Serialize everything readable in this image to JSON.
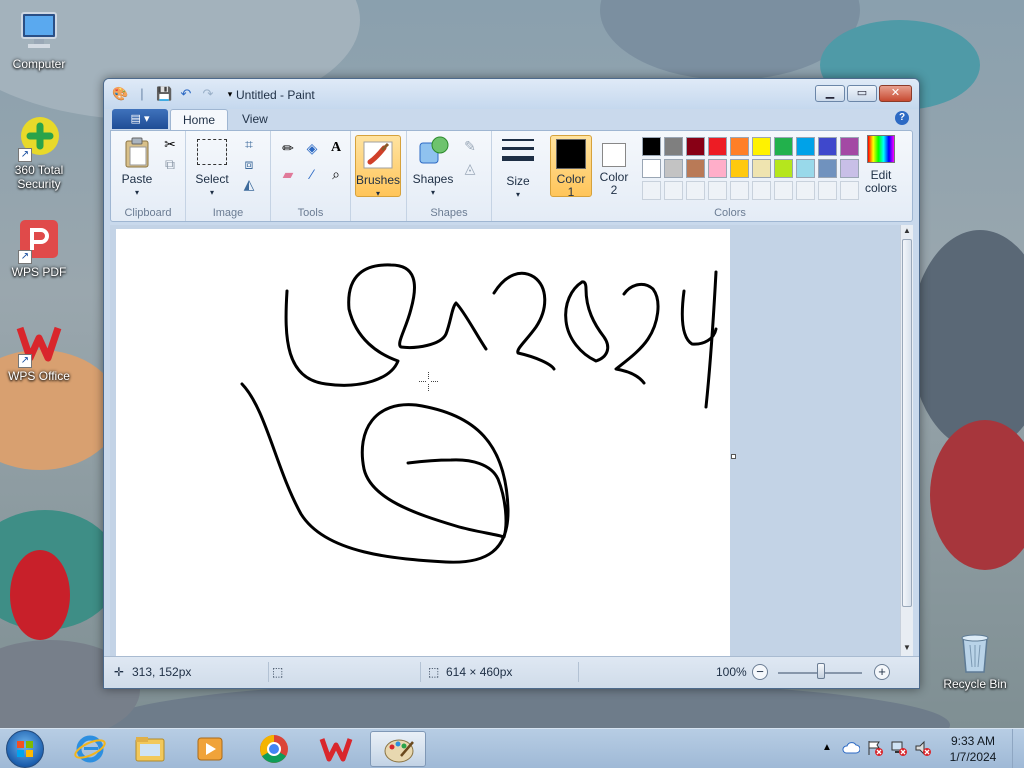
{
  "desktop": {
    "icons": [
      {
        "label": "Computer"
      },
      {
        "label": "360 Total Security"
      },
      {
        "label": "WPS PDF"
      },
      {
        "label": "WPS Office"
      },
      {
        "label": "Recycle Bin"
      }
    ]
  },
  "window": {
    "title": "Untitled - Paint",
    "minimize": "▁",
    "maximize": "▭",
    "close": "✕"
  },
  "tabs": {
    "home": "Home",
    "view": "View",
    "help": "?"
  },
  "ribbon": {
    "clipboard": {
      "label": "Clipboard",
      "paste": "Paste"
    },
    "image": {
      "label": "Image",
      "select": "Select"
    },
    "tools": {
      "label": "Tools"
    },
    "brushes": {
      "label": "Brushes"
    },
    "shapes": {
      "label": "Shapes",
      "shapes_btn": "Shapes"
    },
    "size": {
      "label": "Size"
    },
    "colors": {
      "label": "Colors",
      "color1_line1": "Color",
      "color1_line2": "1",
      "color2_line1": "Color",
      "color2_line2": "2",
      "edit_line1": "Edit",
      "edit_line2": "colors",
      "color1_value": "#000000",
      "color2_value": "#ffffff",
      "palette_row1": [
        "#000000",
        "#7f7f7f",
        "#880015",
        "#ed1c24",
        "#ff7f27",
        "#fff200",
        "#22b14c",
        "#00a2e8",
        "#3f48cc",
        "#a349a4"
      ],
      "palette_row2": [
        "#ffffff",
        "#c3c3c3",
        "#b97a57",
        "#ffaec9",
        "#ffc90e",
        "#efe4b0",
        "#b5e61d",
        "#99d9ea",
        "#7092be",
        "#c8bfe7"
      ]
    }
  },
  "status": {
    "cursor_pos": "313, 152px",
    "canvas_size": "614 × 460px",
    "zoom": "100%"
  },
  "taskbar": {
    "time": "9:33 AM",
    "date": "1/7/2024"
  }
}
